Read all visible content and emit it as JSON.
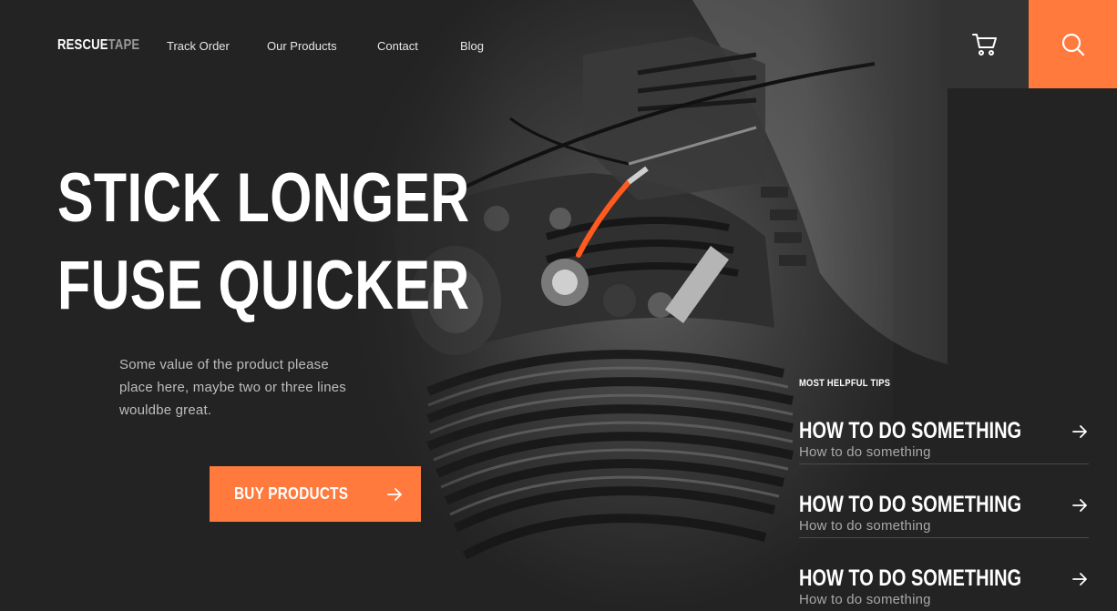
{
  "brand": {
    "logo_bold": "RESCUE",
    "logo_light": "TAPE"
  },
  "nav": {
    "items": [
      {
        "label": "Track Order"
      },
      {
        "label": "Our Products"
      },
      {
        "label": "Contact"
      },
      {
        "label": "Blog"
      }
    ]
  },
  "header_actions": {
    "cart_icon": "cart-icon",
    "search_icon": "search-icon"
  },
  "hero": {
    "headline_line1": "STICK LONGER",
    "headline_line2": "FUSE QUICKER",
    "subtext": "Some value of the product please place here, maybe two or three lines wouldbe great.",
    "cta_label": "BUY PRODUCTS",
    "cta_icon": "arrow-right-icon"
  },
  "tips": {
    "title": "MOST HELPFUL TIPS",
    "items": [
      {
        "title": "HOW TO DO SOMETHING",
        "subtitle": "How to do something"
      },
      {
        "title": "HOW TO DO SOMETHING",
        "subtitle": "How to do something"
      },
      {
        "title": "HOW TO DO SOMETHING",
        "subtitle": "How to do something"
      }
    ]
  },
  "colors": {
    "accent": "#ff7a3c",
    "background": "#232323",
    "cart_bg": "#333333",
    "hose": "#ff5a1f"
  }
}
